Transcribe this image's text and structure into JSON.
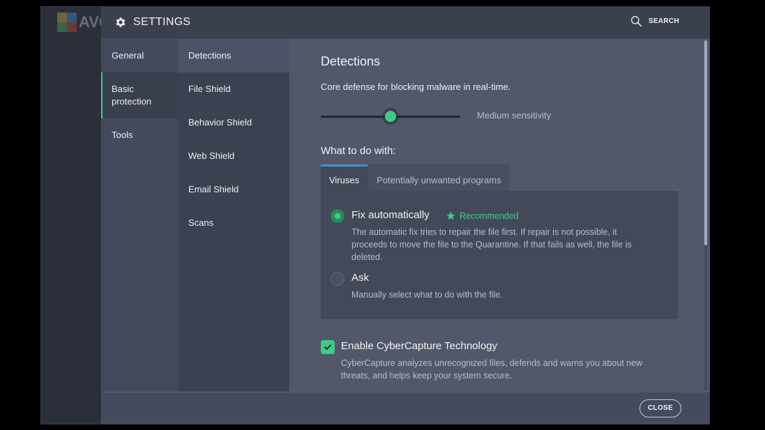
{
  "app": {
    "logo_text": "AVG",
    "logo_icon": "avg-logo-icon"
  },
  "header": {
    "title": "SETTINGS",
    "title_icon": "gear-icon",
    "search_label": "SEARCH",
    "search_icon": "search-icon"
  },
  "nav_primary": {
    "items": [
      {
        "label": "General",
        "active": false
      },
      {
        "label": "Basic\nprotection",
        "active": true
      },
      {
        "label": "Tools",
        "active": false
      }
    ]
  },
  "nav_secondary": {
    "items": [
      {
        "label": "Detections",
        "active": true
      },
      {
        "label": "File Shield",
        "active": false
      },
      {
        "label": "Behavior Shield",
        "active": false
      },
      {
        "label": "Web Shield",
        "active": false
      },
      {
        "label": "Email Shield",
        "active": false
      },
      {
        "label": "Scans",
        "active": false
      }
    ]
  },
  "content": {
    "title": "Detections",
    "description": "Core defense for blocking malware in real-time.",
    "sensitivity": {
      "label": "Medium sensitivity",
      "value_fraction": 0.5
    },
    "what_to_do_heading": "What to do with:",
    "tabs": [
      {
        "label": "Viruses",
        "active": true
      },
      {
        "label": "Potentially unwanted programs",
        "active": false
      }
    ],
    "options": [
      {
        "title": "Fix automatically",
        "selected": true,
        "badge": "Recommended",
        "badge_icon": "star-icon",
        "description": "The automatic fix tries to repair the file first. If repair is not possible, it proceeds to move the file to the Quarantine. If that fails as well, the file is deleted."
      },
      {
        "title": "Ask",
        "selected": false,
        "description": "Manually select what to do with the file."
      }
    ],
    "cybercapture": {
      "title": "Enable CyberCapture Technology",
      "checked": true,
      "description": "CyberCapture analyzes unrecognized files, defends and warns you about new threats, and helps keep your system secure."
    }
  },
  "footer": {
    "close_label": "CLOSE"
  },
  "colors": {
    "accent_green": "#3ecb88",
    "tab_accent_blue": "#3c94d6"
  }
}
